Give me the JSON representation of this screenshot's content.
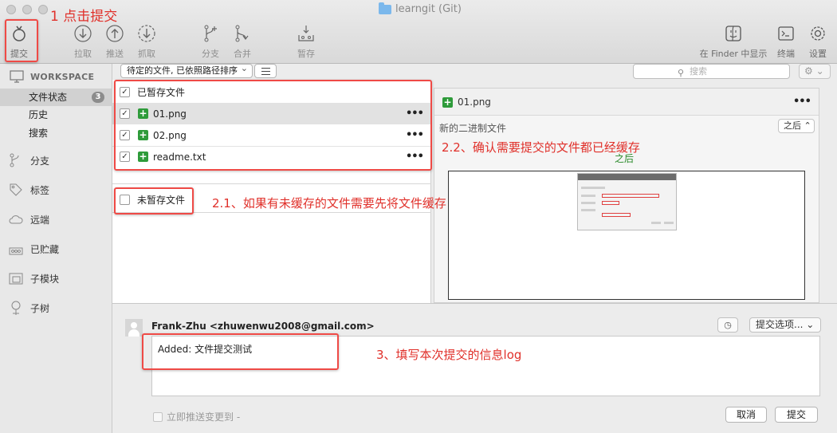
{
  "window": {
    "title": "learngit (Git)"
  },
  "toolbar": {
    "commit": "提交",
    "pull": "拉取",
    "push": "推送",
    "fetch": "抓取",
    "branch": "分支",
    "merge": "合并",
    "stash": "暂存",
    "show_in_finder": "在 Finder 中显示",
    "terminal": "终端",
    "settings": "设置"
  },
  "sidebar": {
    "workspace": "WORKSPACE",
    "file_status": "文件状态",
    "file_status_count": "3",
    "history": "历史",
    "search": "搜索",
    "items": [
      {
        "label": "分支",
        "icon": "branch-icon"
      },
      {
        "label": "标签",
        "icon": "tag-icon"
      },
      {
        "label": "远端",
        "icon": "cloud-icon"
      },
      {
        "label": "已贮藏",
        "icon": "stash-icon"
      },
      {
        "label": "子模块",
        "icon": "submodule-icon"
      },
      {
        "label": "子树",
        "icon": "subtree-icon"
      }
    ]
  },
  "filter": {
    "sort_select": "待定的文件, 已依照路径排序",
    "search_placeholder": "搜索"
  },
  "staged": {
    "header": "已暂存文件",
    "files": [
      {
        "name": "01.png",
        "status": "added"
      },
      {
        "name": "02.png",
        "status": "added"
      },
      {
        "name": "readme.txt",
        "status": "added"
      }
    ]
  },
  "unstaged": {
    "header": "未暂存文件"
  },
  "preview": {
    "file_name": "01.png",
    "subtitle": "新的二进制文件",
    "version_select": "之后",
    "after_label": "之后"
  },
  "commit": {
    "author": "Frank-Zhu <zhuwenwu2008@gmail.com>",
    "options_button": "提交选项...",
    "message": "Added: 文件提交测试",
    "push_immediately": "立即推送变更到 -",
    "cancel": "取消",
    "submit": "提交"
  },
  "annotations": {
    "step1": "1 点击提交",
    "step21": "2.1、如果有未缓存的文件需要先将文件缓存",
    "step22": "2.2、确认需要提交的文件都已经缓存",
    "step3": "3、填写本次提交的信息log",
    "accent": "#e0302a"
  },
  "colors": {
    "added_green": "#2e9b3a"
  }
}
